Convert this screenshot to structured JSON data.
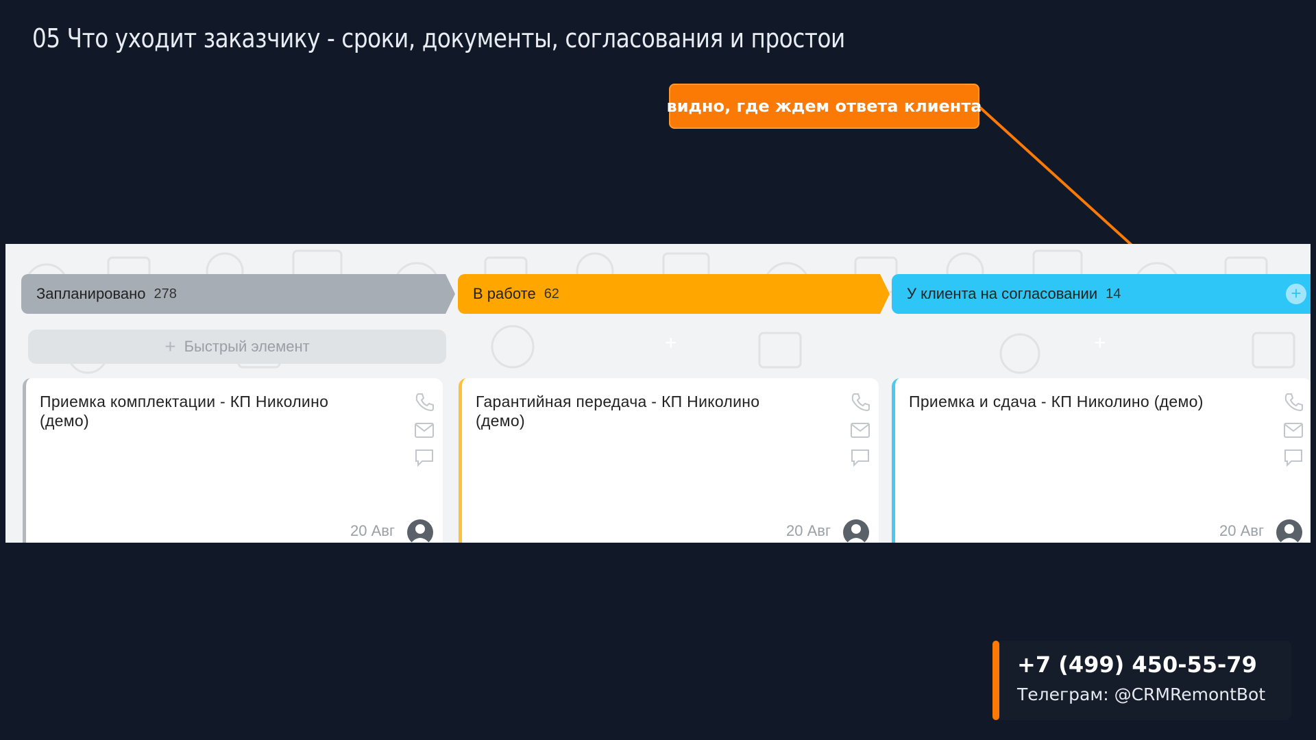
{
  "slide": {
    "title": "05 Что уходит заказчику - сроки, документы, согласования и простои"
  },
  "callout": {
    "text": "видно, где ждем ответа клиента"
  },
  "board": {
    "stages": [
      {
        "label": "Запланировано",
        "count": "278",
        "color": "#a7adb5"
      },
      {
        "label": "В работе",
        "count": "62",
        "color": "#ffa600"
      },
      {
        "label": "У клиента на согласовании",
        "count": "14",
        "color": "#2dc6f6"
      }
    ],
    "stage_add_icon": "plus-icon",
    "quick_add": {
      "icon": "plus-icon",
      "label": "Быстрый элемент"
    },
    "cards": [
      {
        "title": "Приемка комплектации - КП Николино (демо)",
        "date": "20 Авг",
        "accent": "#b3b8bf"
      },
      {
        "title": "Гарантийная передача - КП Николино (демо)",
        "date": "20 Авг",
        "accent": "#ffbf3a"
      },
      {
        "title": "Приемка и сдача - КП Николино (демо)",
        "date": "20 Авг",
        "accent": "#4cc9f0"
      }
    ],
    "card_icons": [
      "phone-icon",
      "mail-icon",
      "comment-icon"
    ]
  },
  "contact": {
    "phone": "+7 (499) 450-55-79",
    "telegram": "Телеграм: @CRMRemontBot",
    "accent": "#fb7a06"
  }
}
